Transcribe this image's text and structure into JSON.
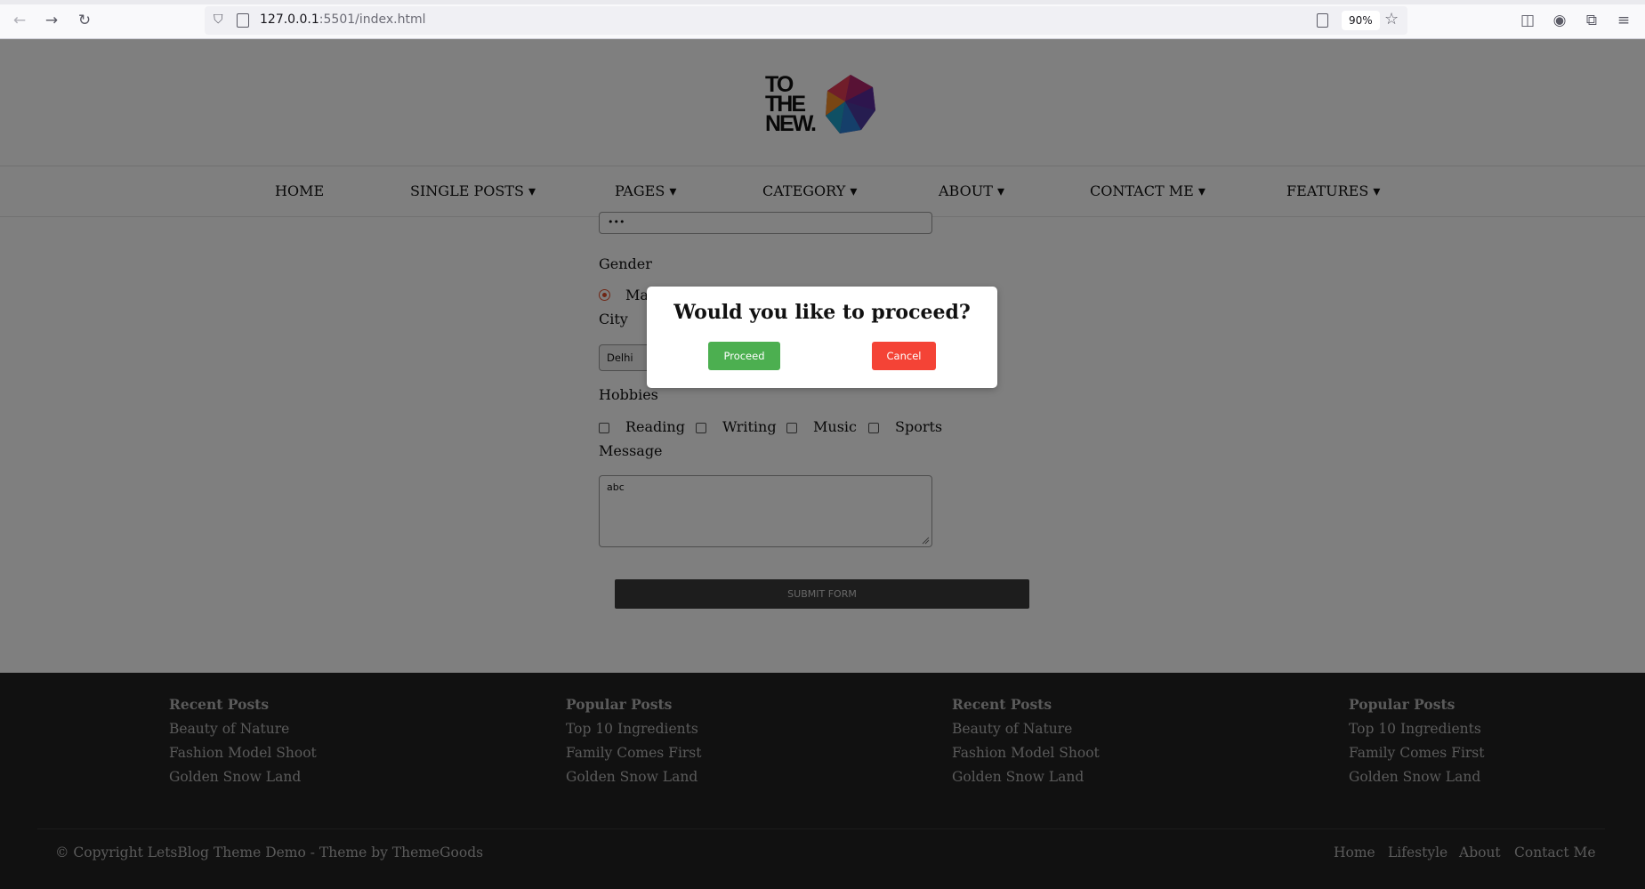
{
  "browser": {
    "url_host": "127.0.0.1",
    "url_rest": ":5501/index.html",
    "zoom": "90%"
  },
  "logo": {
    "text": "TO THE NEW"
  },
  "nav": {
    "items": [
      "HOME",
      "SINGLE POSTS ▾",
      "PAGES ▾",
      "CATEGORY ▾",
      "ABOUT ▾",
      "CONTACT ME ▾",
      "FEATURES ▾"
    ]
  },
  "form": {
    "password_value": "•••",
    "gender_label": "Gender",
    "gender_option": "Male",
    "city_label": "City",
    "city_value": "Delhi",
    "hobbies_label": "Hobbies",
    "hobbies": [
      "Reading",
      "Writing",
      "Music",
      "Sports"
    ],
    "message_label": "Message",
    "message_value": "abc",
    "submit_label": "SUBMIT FORM"
  },
  "modal": {
    "title": "Would you like to proceed?",
    "proceed_label": "Proceed",
    "cancel_label": "Cancel",
    "proceed_color": "#4caf50",
    "cancel_color": "#f44336"
  },
  "footer": {
    "columns": [
      {
        "title": "Recent Posts",
        "links": [
          "Beauty of Nature",
          "Fashion Model Shoot",
          "Golden Snow Land"
        ]
      },
      {
        "title": "Popular Posts",
        "links": [
          "Top 10 Ingredients",
          "Family Comes First",
          "Golden Snow Land"
        ]
      },
      {
        "title": "Recent Posts",
        "links": [
          "Beauty of Nature",
          "Fashion Model Shoot",
          "Golden Snow Land"
        ]
      },
      {
        "title": "Popular Posts",
        "links": [
          "Top 10 Ingredients",
          "Family Comes First",
          "Golden Snow Land"
        ]
      }
    ],
    "copyright": "© Copyright LetsBlog Theme Demo - Theme by ThemeGoods",
    "nav": [
      "Home",
      "Lifestyle",
      "About",
      "Contact Me"
    ]
  }
}
